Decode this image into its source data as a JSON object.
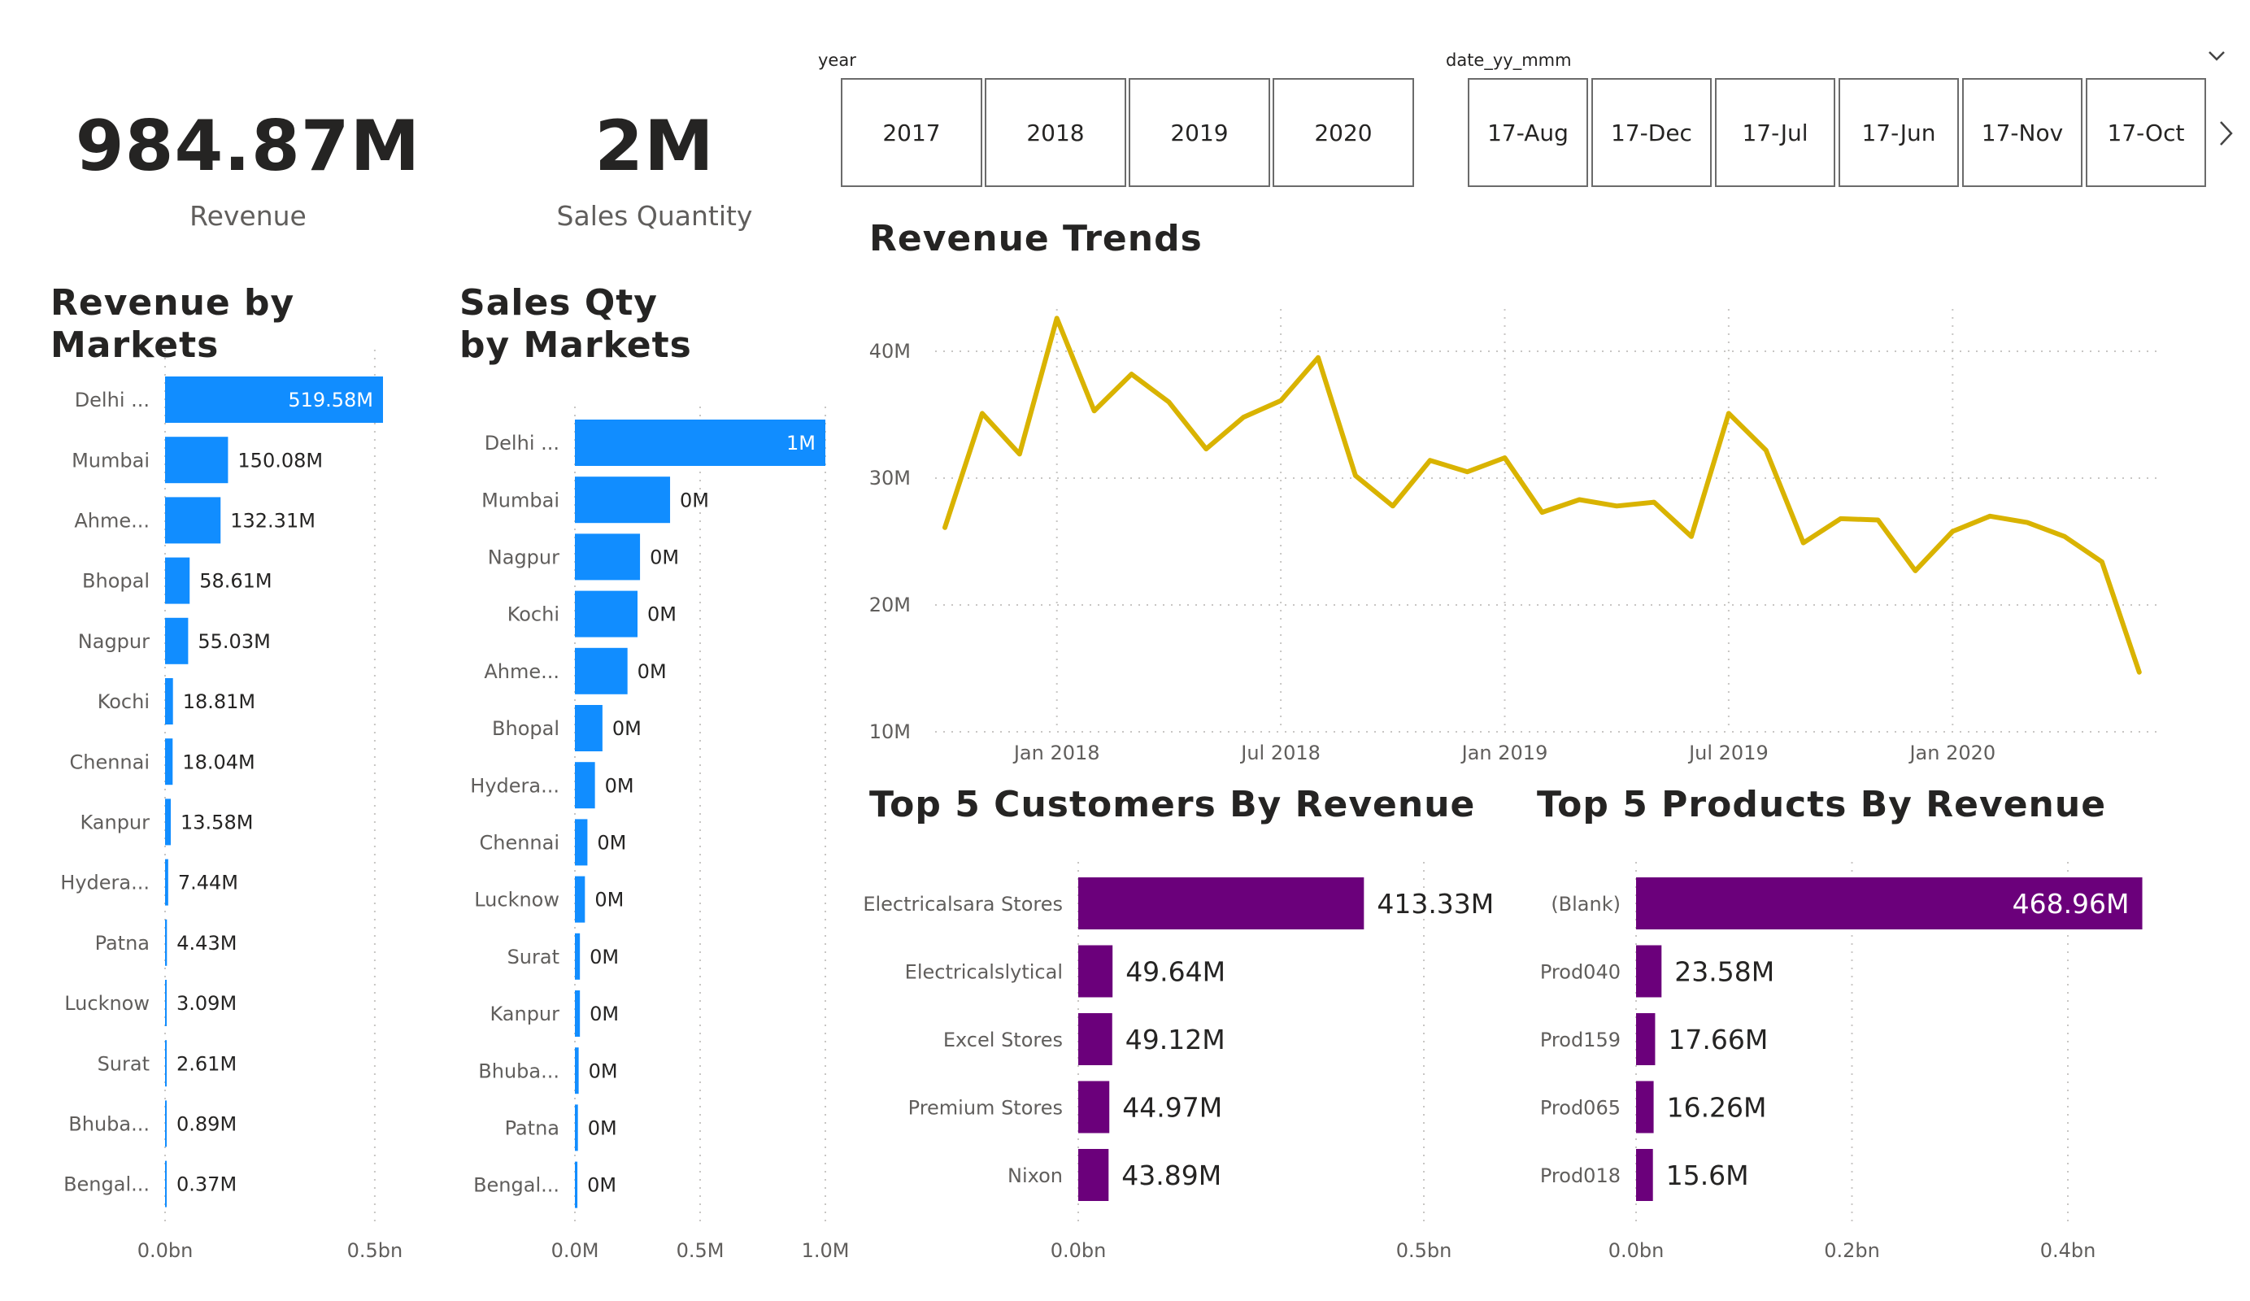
{
  "kpis": [
    {
      "value": "984.87M",
      "label": "Revenue"
    },
    {
      "value": "2M",
      "label": "Sales Quantity"
    }
  ],
  "slicers": {
    "year": {
      "label": "year",
      "items": [
        "2017",
        "2018",
        "2019",
        "2020"
      ]
    },
    "date": {
      "label": "date_yy_mmm",
      "items": [
        "17-Aug",
        "17-Dec",
        "17-Jul",
        "17-Jun",
        "17-Nov",
        "17-Oct"
      ]
    }
  },
  "colors": {
    "market_bar": "#118dff",
    "purple_bar": "#6b007b",
    "trend_line": "#d9b300",
    "grid": "#c8c6c4"
  },
  "icons": {
    "dropdown": "chevron-down-icon",
    "next": "chevron-right-icon"
  },
  "charts": {
    "revenue_by_markets": {
      "title": "Revenue by Markets",
      "type": "bar",
      "orientation": "horizontal",
      "categories": [
        "Delhi ...",
        "Mumbai",
        "Ahme...",
        "Bhopal",
        "Nagpur",
        "Kochi",
        "Chennai",
        "Kanpur",
        "Hydera...",
        "Patna",
        "Lucknow",
        "Surat",
        "Bhuba...",
        "Bengal..."
      ],
      "values": [
        519.58,
        150.08,
        132.31,
        58.61,
        55.03,
        18.81,
        18.04,
        13.58,
        7.44,
        4.43,
        3.09,
        2.61,
        0.89,
        0.37
      ],
      "data_labels": [
        "519.58M",
        "150.08M",
        "132.31M",
        "58.61M",
        "55.03M",
        "18.81M",
        "18.04M",
        "13.58M",
        "7.44M",
        "4.43M",
        "3.09M",
        "2.61M",
        "0.89M",
        "0.37M"
      ],
      "unit": "M",
      "xlim": [
        0,
        519.58
      ],
      "ticks": [
        0,
        500
      ],
      "tick_labels": [
        "0.0bn",
        "0.5bn"
      ]
    },
    "sales_qty_by_markets": {
      "title": "Sales Qty by Markets",
      "type": "bar",
      "orientation": "horizontal",
      "categories": [
        "Delhi ...",
        "Mumbai",
        "Nagpur",
        "Kochi",
        "Ahme...",
        "Bhopal",
        "Hydera...",
        "Chennai",
        "Lucknow",
        "Surat",
        "Kanpur",
        "Bhuba...",
        "Patna",
        "Bengal..."
      ],
      "values": [
        1.0,
        0.38,
        0.26,
        0.25,
        0.21,
        0.11,
        0.08,
        0.05,
        0.04,
        0.02,
        0.02,
        0.015,
        0.012,
        0.01
      ],
      "data_labels": [
        "1M",
        "0M",
        "0M",
        "0M",
        "0M",
        "0M",
        "0M",
        "0M",
        "0M",
        "0M",
        "0M",
        "0M",
        "0M",
        "0M"
      ],
      "unit": "M",
      "xlim": [
        0,
        1.0
      ],
      "ticks": [
        0,
        0.5,
        1.0
      ],
      "tick_labels": [
        "0.0M",
        "0.5M",
        "1.0M"
      ]
    },
    "revenue_trends": {
      "title": "Revenue Trends",
      "type": "line",
      "x": [
        "2017-10",
        "2017-11",
        "2017-12",
        "2018-01",
        "2018-02",
        "2018-03",
        "2018-04",
        "2018-05",
        "2018-06",
        "2018-07",
        "2018-08",
        "2018-09",
        "2018-10",
        "2018-11",
        "2018-12",
        "2019-01",
        "2019-02",
        "2019-03",
        "2019-04",
        "2019-05",
        "2019-06",
        "2019-07",
        "2019-08",
        "2019-09",
        "2019-10",
        "2019-11",
        "2019-12",
        "2020-01",
        "2020-02",
        "2020-03",
        "2020-04",
        "2020-05",
        "2020-06"
      ],
      "y": [
        26.1,
        35.1,
        31.9,
        42.6,
        35.3,
        38.2,
        36.0,
        32.3,
        34.8,
        36.1,
        39.5,
        30.2,
        27.8,
        31.4,
        30.5,
        31.6,
        27.3,
        28.3,
        27.8,
        28.1,
        25.4,
        35.1,
        32.2,
        24.9,
        26.8,
        26.7,
        22.7,
        25.8,
        27.0,
        26.5,
        25.4,
        23.4,
        14.7
      ],
      "ylim": [
        10,
        42.6
      ],
      "yticks": [
        10,
        20,
        30,
        40
      ],
      "ytick_labels": [
        "10M",
        "20M",
        "30M",
        "40M"
      ],
      "xticks": [
        "2018-01",
        "2018-07",
        "2019-01",
        "2019-07",
        "2020-01"
      ],
      "xtick_labels": [
        "Jan 2018",
        "Jul 2018",
        "Jan 2019",
        "Jul 2019",
        "Jan 2020"
      ],
      "grid": true
    },
    "top_customers": {
      "title": "Top 5 Customers By Revenue",
      "type": "bar",
      "orientation": "horizontal",
      "categories": [
        "Electricalsara Stores",
        "Electricalslytical",
        "Excel Stores",
        "Premium Stores",
        "Nixon"
      ],
      "values": [
        413.33,
        49.64,
        49.12,
        44.97,
        43.89
      ],
      "data_labels": [
        "413.33M",
        "49.64M",
        "49.12M",
        "44.97M",
        "43.89M"
      ],
      "unit": "M",
      "xlim": [
        0,
        413.33
      ],
      "ticks": [
        0,
        500
      ],
      "tick_labels": [
        "0.0bn",
        "0.5bn"
      ]
    },
    "top_products": {
      "title": "Top 5 Products By Revenue",
      "type": "bar",
      "orientation": "horizontal",
      "categories": [
        "(Blank)",
        "Prod040",
        "Prod159",
        "Prod065",
        "Prod018"
      ],
      "values": [
        468.96,
        23.58,
        17.66,
        16.26,
        15.6
      ],
      "data_labels": [
        "468.96M",
        "23.58M",
        "17.66M",
        "16.26M",
        "15.6M"
      ],
      "unit": "M",
      "xlim": [
        0,
        468.96
      ],
      "ticks": [
        0,
        200,
        400
      ],
      "tick_labels": [
        "0.0bn",
        "0.2bn",
        "0.4bn"
      ]
    }
  }
}
